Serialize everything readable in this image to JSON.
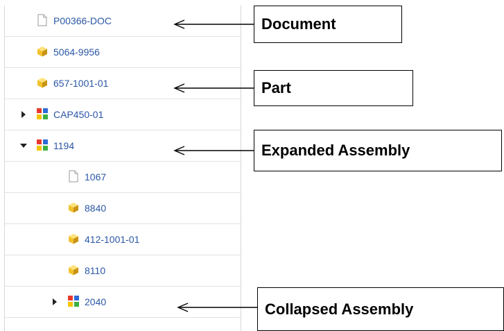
{
  "tree": {
    "items": [
      {
        "label": "P00366-DOC",
        "icon": "document-icon",
        "level": 0,
        "toggle": "none",
        "kind": "document"
      },
      {
        "label": "5064-9956",
        "icon": "part-icon",
        "level": 0,
        "toggle": "none",
        "kind": "part"
      },
      {
        "label": "657-1001-01",
        "icon": "part-icon",
        "level": 0,
        "toggle": "none",
        "kind": "part"
      },
      {
        "label": "CAP450-01",
        "icon": "assembly-icon",
        "level": 0,
        "toggle": "collapsed",
        "kind": "assembly"
      },
      {
        "label": "1194",
        "icon": "assembly-icon",
        "level": 0,
        "toggle": "expanded",
        "kind": "assembly"
      },
      {
        "label": "1067",
        "icon": "document-icon",
        "level": 1,
        "toggle": "none",
        "kind": "document"
      },
      {
        "label": "8840",
        "icon": "part-icon",
        "level": 1,
        "toggle": "none",
        "kind": "part"
      },
      {
        "label": "412-1001-01",
        "icon": "part-icon",
        "level": 1,
        "toggle": "none",
        "kind": "part"
      },
      {
        "label": "8110",
        "icon": "part-icon",
        "level": 1,
        "toggle": "none",
        "kind": "part"
      },
      {
        "label": "2040",
        "icon": "assembly-icon",
        "level": 1,
        "toggle": "collapsed",
        "kind": "assembly"
      }
    ]
  },
  "callouts": [
    {
      "label": "Document",
      "target_row": 0
    },
    {
      "label": "Part",
      "target_row": 2
    },
    {
      "label": "Expanded Assembly",
      "target_row": 4
    },
    {
      "label": "Collapsed Assembly",
      "target_row": 9
    }
  ],
  "colors": {
    "link": "#2b57a6",
    "divider": "#e2e2e2",
    "part_gold": "#f2c12e",
    "assembly_red": "#e8372c",
    "assembly_blue": "#2e6ad8",
    "assembly_green": "#3cb043",
    "assembly_yellow": "#f5c400"
  }
}
